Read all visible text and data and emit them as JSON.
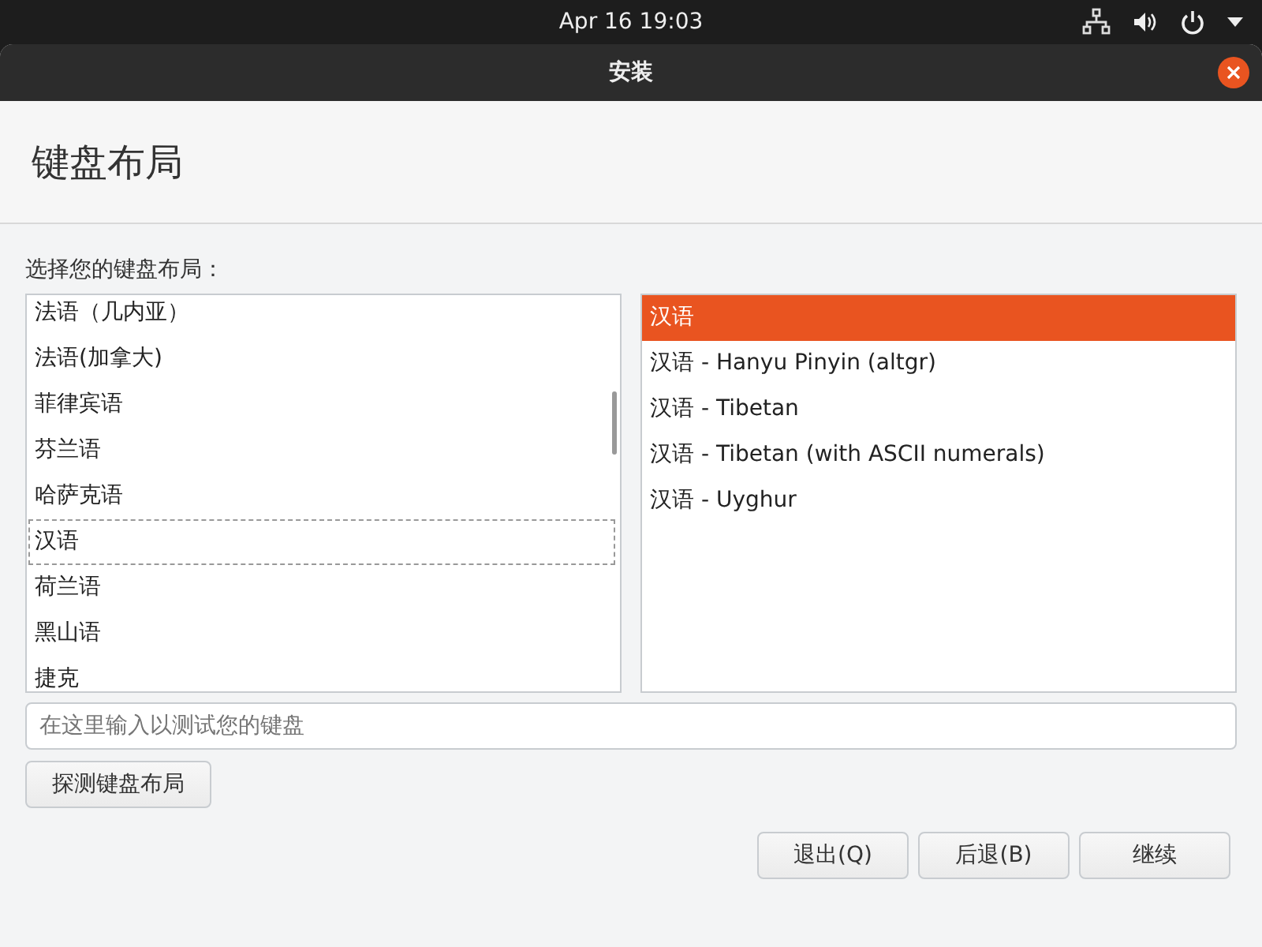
{
  "top_bar": {
    "clock": "Apr 16  19:03"
  },
  "window": {
    "title": "安装"
  },
  "page": {
    "heading": "键盘布局",
    "prompt": "选择您的键盘布局："
  },
  "layouts": [
    {
      "label": "法语（几内亚）",
      "selected": false
    },
    {
      "label": "法语(加拿大)",
      "selected": false
    },
    {
      "label": "菲律宾语",
      "selected": false
    },
    {
      "label": "芬兰语",
      "selected": false
    },
    {
      "label": "哈萨克语",
      "selected": false
    },
    {
      "label": "汉语",
      "selected": true
    },
    {
      "label": "荷兰语",
      "selected": false
    },
    {
      "label": "黑山语",
      "selected": false
    },
    {
      "label": "捷克",
      "selected": false
    }
  ],
  "variants": [
    {
      "label": "汉语",
      "selected": true
    },
    {
      "label": "汉语 - Hanyu Pinyin (altgr)",
      "selected": false
    },
    {
      "label": "汉语 - Tibetan",
      "selected": false
    },
    {
      "label": "汉语 - Tibetan (with ASCII numerals)",
      "selected": false
    },
    {
      "label": "汉语 - Uyghur",
      "selected": false
    }
  ],
  "test_field": {
    "placeholder": "在这里输入以测试您的键盘"
  },
  "detect_button": "探测键盘布局",
  "buttons": [
    "退出(Q)",
    "后退(B)",
    "继续"
  ]
}
